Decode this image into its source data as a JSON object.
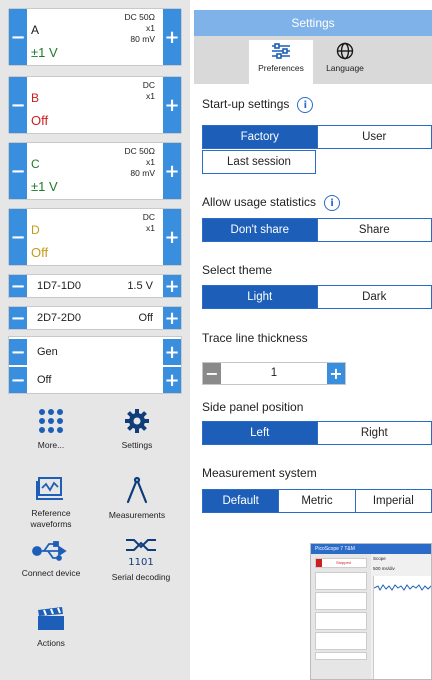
{
  "channels": [
    {
      "name": "A",
      "coupling": "DC 50Ω",
      "probe": "x1",
      "offset": "80 mV",
      "range": "±1 V",
      "color": "#1a1a1a",
      "range_color": "#1e7a2a"
    },
    {
      "name": "B",
      "coupling": "DC",
      "probe": "x1",
      "offset": "",
      "range": "Off",
      "color": "#cc1f1f",
      "range_color": "#cc1f1f"
    },
    {
      "name": "C",
      "coupling": "DC 50Ω",
      "probe": "x1",
      "offset": "80 mV",
      "range": "±1 V",
      "color": "#1e7a2a",
      "range_color": "#1e7a2a"
    },
    {
      "name": "D",
      "coupling": "DC",
      "probe": "x1",
      "offset": "",
      "range": "Off",
      "color": "#c59a1b",
      "range_color": "#c59a1b"
    }
  ],
  "digital": [
    {
      "label": "1D7-1D0",
      "value": "1.5 V"
    },
    {
      "label": "2D7-2D0",
      "value": "Off"
    }
  ],
  "generator": {
    "label": "Gen",
    "value": "Off"
  },
  "tools": [
    "More...",
    "Settings",
    "Reference waveforms",
    "Measurements",
    "Connect device",
    "Serial decoding",
    "Actions"
  ],
  "settings": {
    "title": "Settings",
    "tabs": [
      "Preferences",
      "Language"
    ],
    "startup": {
      "label": "Start-up settings",
      "options": [
        "Factory",
        "User",
        "Last session"
      ]
    },
    "usage": {
      "label": "Allow usage statistics",
      "options": [
        "Don't share",
        "Share"
      ]
    },
    "theme": {
      "label": "Select theme",
      "options": [
        "Light",
        "Dark"
      ]
    },
    "trace": {
      "label": "Trace line thickness",
      "value": "1"
    },
    "sidepanel": {
      "label": "Side panel position",
      "options": [
        "Left",
        "Right"
      ]
    },
    "measurement": {
      "label": "Measurement system",
      "options": [
        "Default",
        "Metric",
        "Imperial"
      ]
    }
  },
  "mini": {
    "title": "PicoScope 7 T&M",
    "stop": "Stopped",
    "scope": "Scope",
    "timebase": "500 ms/div"
  },
  "colors": {
    "accent": "#1d5fb8",
    "button": "#3a8ede",
    "header": "#7fb2e8"
  }
}
